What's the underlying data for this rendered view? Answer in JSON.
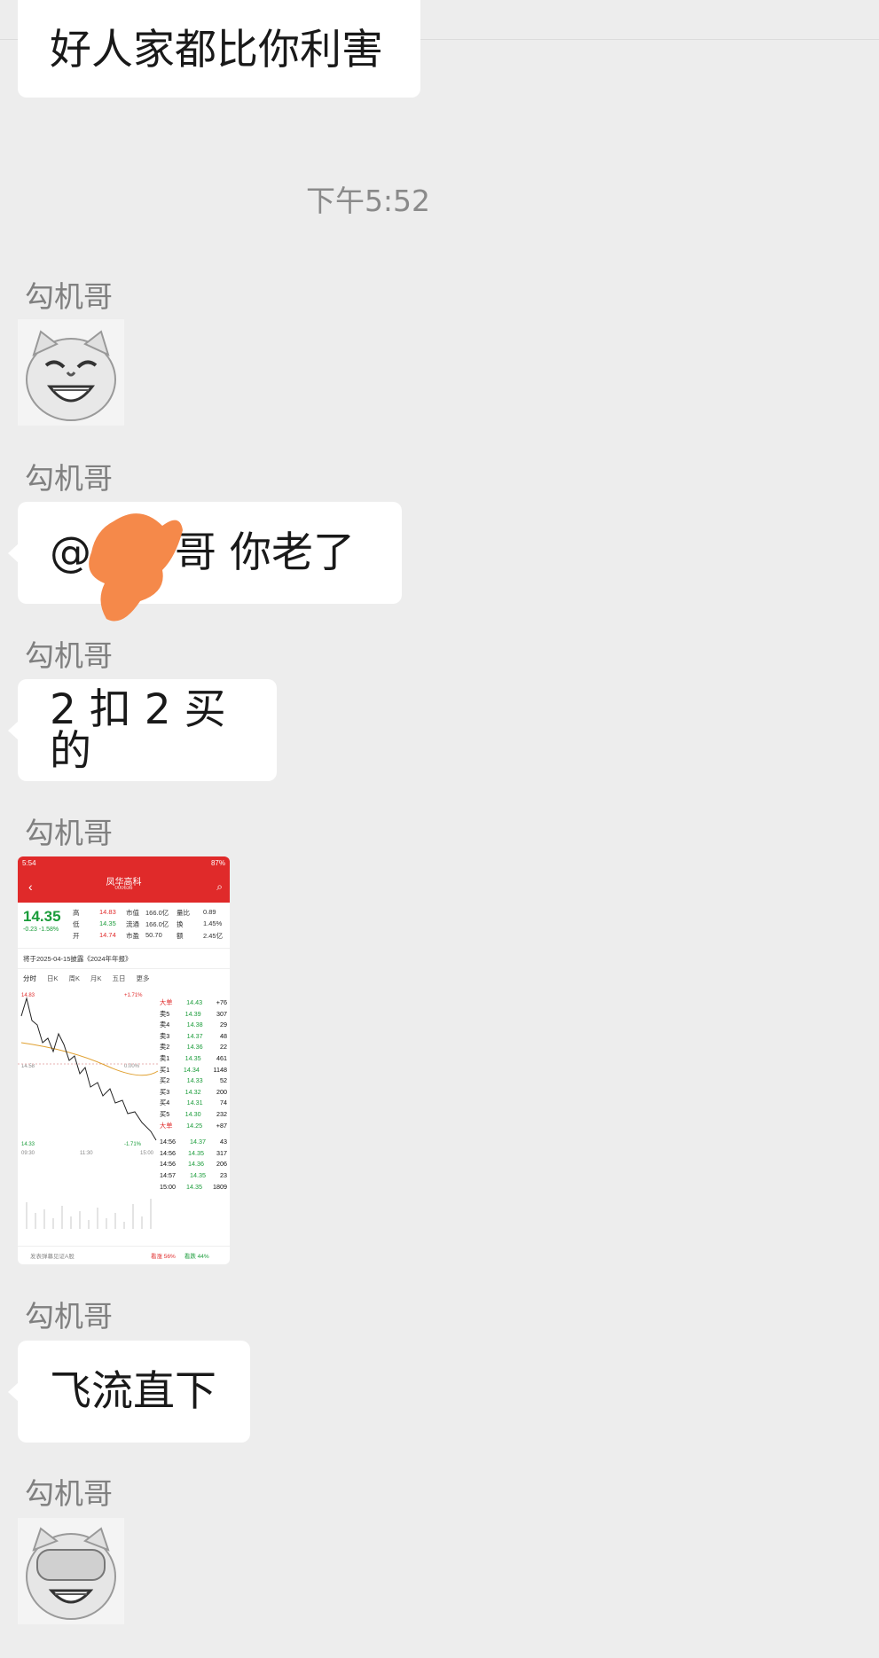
{
  "top_partial_message": "好人家都比你利害",
  "timestamp": "下午5:52",
  "messages": [
    {
      "sender": "勾机哥",
      "kind": "sticker",
      "icon": "laughing-pig-sticker"
    },
    {
      "sender": "勾机哥",
      "kind": "text",
      "text": "@　　哥  你老了"
    },
    {
      "sender": "勾机哥",
      "kind": "text",
      "text": "2 扣 2 买的"
    },
    {
      "sender": "勾机哥",
      "kind": "image",
      "icon": "stock-chart-screenshot"
    },
    {
      "sender": "勾机哥",
      "kind": "text",
      "text": "飞流直下"
    },
    {
      "sender": "勾机哥",
      "kind": "sticker",
      "icon": "facepalm-pig-sticker"
    }
  ],
  "screenshot": {
    "status_time": "5:54",
    "battery": "87%",
    "stock_name": "凤华高科",
    "stock_code": "000636",
    "price": "14.35",
    "change": "-0.23  -1.58%",
    "quote_rows": [
      [
        "高",
        "14.83",
        "市值",
        "166.0亿",
        "量比",
        "0.89"
      ],
      [
        "低",
        "14.35",
        "流通",
        "166.0亿",
        "换",
        "1.45%"
      ],
      [
        "开",
        "14.74",
        "市盈",
        "50.70",
        "额",
        "2.45亿"
      ]
    ],
    "announcement": "将于2025-04-15披露《2024年年报》",
    "tabs": [
      "分时",
      "日K",
      "周K",
      "月K",
      "五日",
      "更多"
    ],
    "chart_high": "14.83",
    "chart_mid": "14.58",
    "chart_low": "14.33",
    "chart_pct_high": "+1.71%",
    "chart_pct_mid": "0.00%",
    "chart_pct_low": "-1.71%",
    "time_axis": [
      "09:30",
      "11:30",
      "15:00"
    ],
    "order_book": [
      [
        "大单",
        "14.43",
        "+76"
      ],
      [
        "卖5",
        "14.39",
        "307"
      ],
      [
        "卖4",
        "14.38",
        "29"
      ],
      [
        "卖3",
        "14.37",
        "48"
      ],
      [
        "卖2",
        "14.36",
        "22"
      ],
      [
        "卖1",
        "14.35",
        "461"
      ],
      [
        "买1",
        "14.34",
        "1148"
      ],
      [
        "买2",
        "14.33",
        "52"
      ],
      [
        "买3",
        "14.32",
        "200"
      ],
      [
        "买4",
        "14.31",
        "74"
      ],
      [
        "买5",
        "14.30",
        "232"
      ],
      [
        "大单",
        "14.25",
        "+87"
      ]
    ],
    "trades": [
      [
        "14:56",
        "14.37",
        "43"
      ],
      [
        "14:56",
        "14.35",
        "317"
      ],
      [
        "14:56",
        "14.36",
        "206"
      ],
      [
        "14:57",
        "14.35",
        "23"
      ],
      [
        "15:00",
        "14.35",
        "1809"
      ]
    ],
    "bottom_hint": "发表弹幕见证A股",
    "bottom_up": "看涨 56%",
    "bottom_down": "看跌 44%",
    "colors": {
      "red": "#e02a2a",
      "green": "#1a9c3a"
    }
  },
  "colors": {
    "background": "#ededed",
    "bubble": "#ffffff",
    "sender_text": "#808080",
    "redaction": "#f5894a"
  }
}
